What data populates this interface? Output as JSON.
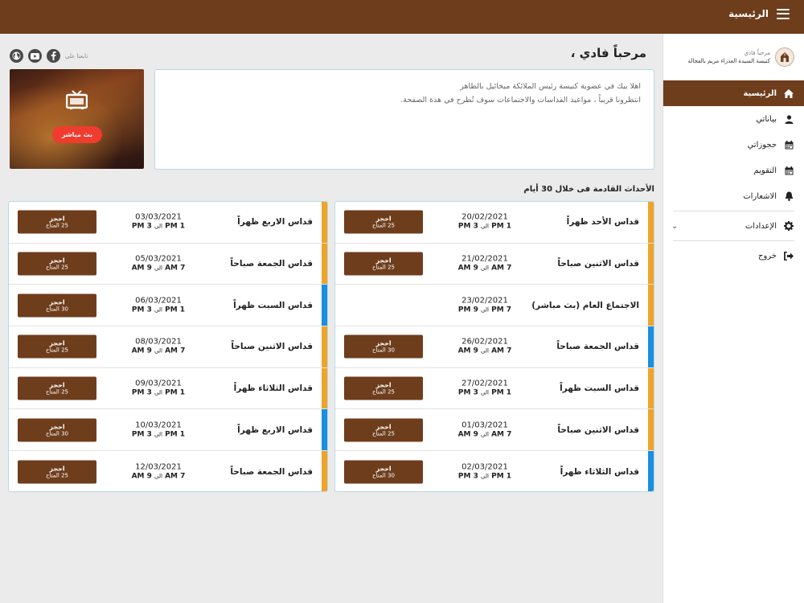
{
  "header": {
    "title": "الرئيسية"
  },
  "profile": {
    "name": "مرحباً فادي",
    "church": "كنيسة السيدة العذراء مريم بالفجالة"
  },
  "nav": [
    {
      "label": "الرئيسية",
      "icon": "home-icon",
      "active": true
    },
    {
      "label": "بياناتي",
      "icon": "user-icon"
    },
    {
      "label": "حجوزاتي",
      "icon": "calendar-icon"
    },
    {
      "label": "التقويم",
      "icon": "calendar-icon"
    },
    {
      "label": "الاشعارات",
      "icon": "bell-icon"
    },
    {
      "label": "الإعدادات",
      "icon": "gear-icon"
    },
    {
      "label": "خروج",
      "icon": "logout-icon"
    }
  ],
  "welcome": "مرحباً فادي ،",
  "follow_label": "تابعنا علي",
  "info": {
    "line1": "اهلا بيك في عضوية كنيسة رئيس الملائكة ميخائيل بالظاهر",
    "line2": "انتظرونا قريباً ، مواعيد القداسات والاجتماعات سوف تُطرح في هذة الصفحة."
  },
  "live_button": "بث مباشر",
  "events_heading": "الأحداث القادمة فى خلال 30 أيام",
  "book_label": "احجز",
  "to_label": "الى",
  "colors": {
    "brown": "#6e3d1c",
    "orange": "#f0a32a",
    "blue": "#1a8fe0"
  },
  "events_right": [
    {
      "name": "قداس الأحد ظهراً",
      "date": "20/02/2021",
      "from": "1 PM",
      "to": "3 PM",
      "bookable": true,
      "avail": "25 المتاح",
      "color": "orange"
    },
    {
      "name": "قداس الاثنين صباحاً",
      "date": "21/02/2021",
      "from": "7 AM",
      "to": "9 AM",
      "bookable": true,
      "avail": "25 المتاح",
      "color": "orange"
    },
    {
      "name": "الاجتماع العام (بث مباشر)",
      "date": "23/02/2021",
      "from": "7 PM",
      "to": "9 PM",
      "bookable": false,
      "avail": "",
      "color": "orange"
    },
    {
      "name": "قداس الجمعة صباحاً",
      "date": "26/02/2021",
      "from": "7 AM",
      "to": "9 AM",
      "bookable": true,
      "avail": "30 المتاح",
      "color": "blue"
    },
    {
      "name": "قداس السبت ظهراً",
      "date": "27/02/2021",
      "from": "1 PM",
      "to": "3 PM",
      "bookable": true,
      "avail": "25 المتاح",
      "color": "orange"
    },
    {
      "name": "قداس الاثنين صباحاً",
      "date": "01/03/2021",
      "from": "7 AM",
      "to": "9 AM",
      "bookable": true,
      "avail": "25 المتاح",
      "color": "orange"
    },
    {
      "name": "قداس الثلاثاء ظهراً",
      "date": "02/03/2021",
      "from": "1 PM",
      "to": "3 PM",
      "bookable": true,
      "avail": "30 المتاح",
      "color": "blue"
    }
  ],
  "events_left": [
    {
      "name": "قداس الاربع ظهراً",
      "date": "03/03/2021",
      "from": "1 PM",
      "to": "3 PM",
      "bookable": true,
      "avail": "25 المتاح",
      "color": "orange"
    },
    {
      "name": "قداس الجمعة صباحاً",
      "date": "05/03/2021",
      "from": "7 AM",
      "to": "9 AM",
      "bookable": true,
      "avail": "25 المتاح",
      "color": "orange"
    },
    {
      "name": "قداس السبت ظهراً",
      "date": "06/03/2021",
      "from": "1 PM",
      "to": "3 PM",
      "bookable": true,
      "avail": "30 المتاح",
      "color": "blue"
    },
    {
      "name": "قداس الاثنين صباحاً",
      "date": "08/03/2021",
      "from": "7 AM",
      "to": "9 AM",
      "bookable": true,
      "avail": "25 المتاح",
      "color": "orange"
    },
    {
      "name": "قداس الثلاثاء ظهراً",
      "date": "09/03/2021",
      "from": "1 PM",
      "to": "3 PM",
      "bookable": true,
      "avail": "25 المتاح",
      "color": "orange"
    },
    {
      "name": "قداس الاربع ظهراً",
      "date": "10/03/2021",
      "from": "1 PM",
      "to": "3 PM",
      "bookable": true,
      "avail": "30 المتاح",
      "color": "blue"
    },
    {
      "name": "قداس الجمعة صباحاً",
      "date": "12/03/2021",
      "from": "7 AM",
      "to": "9 AM",
      "bookable": true,
      "avail": "25 المتاح",
      "color": "orange"
    }
  ]
}
